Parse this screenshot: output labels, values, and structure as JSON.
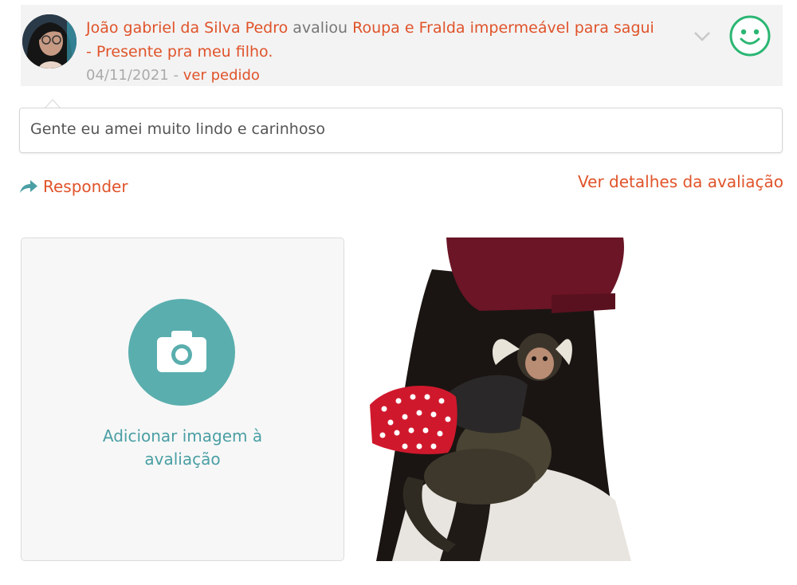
{
  "review": {
    "reviewer_name": "João gabriel da Silva Pedro",
    "action": "avaliou",
    "product_name": "Roupa e Fralda impermeável para sagui - Presente pra meu filho.",
    "date": "04/11/2021",
    "separator": "-",
    "order_link": "ver pedido",
    "comment": "Gente eu amei muito lindo e carinhoso",
    "sentiment_icon": "happy-face-icon",
    "sentiment_color": "#2bb673"
  },
  "actions": {
    "reply_label": "Responder",
    "details_label": "Ver detalhes da avaliação"
  },
  "upload": {
    "label": "Adicionar imagem à avaliação",
    "icon": "camera-icon",
    "circle_color": "#5aaeae"
  },
  "colors": {
    "accent": "#e0532a",
    "teal": "#4a9fa4"
  }
}
